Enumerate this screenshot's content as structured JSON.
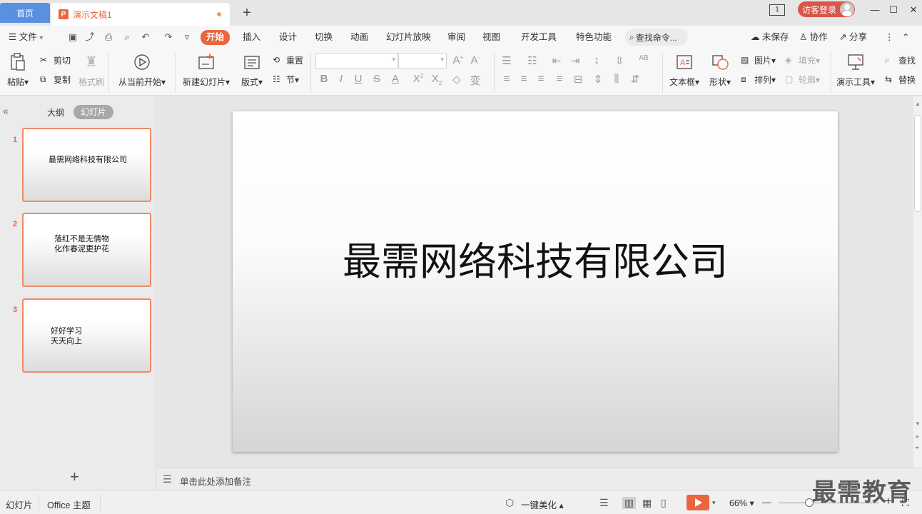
{
  "titlebar": {
    "home_tab": "首页",
    "doc_tab": "演示文稿1",
    "doc_logo": "P",
    "new_tab": "+",
    "window_badge": "1",
    "login": "访客登录",
    "minimize": "—",
    "maximize": "☐",
    "close": "✕"
  },
  "menubar": {
    "file": "文件",
    "tabs": [
      "开始",
      "插入",
      "设计",
      "切换",
      "动画",
      "幻灯片放映",
      "审阅",
      "视图",
      "开发工具",
      "特色功能"
    ],
    "search": "查找命令...",
    "unsaved": "未保存",
    "collab": "协作",
    "share": "分享"
  },
  "ribbon": {
    "paste": "粘贴",
    "cut": "剪切",
    "copy": "复制",
    "format_painter": "格式刷",
    "from_current": "从当前开始",
    "new_slide": "新建幻灯片",
    "layout": "版式",
    "reset": "重置",
    "section": "节",
    "textbox": "文本框",
    "shape": "形状",
    "picture": "图片",
    "arrange": "排列",
    "fill": "填充",
    "outline": "轮廓",
    "present_tools": "演示工具",
    "find": "查找",
    "replace": "替换"
  },
  "leftpanel": {
    "outline_tab": "大纲",
    "slides_tab": "幻灯片",
    "thumbnails": [
      {
        "num": "1",
        "text": "最需网络科技有限公司"
      },
      {
        "num": "2",
        "text": "落红不是无情物\n化作春泥更护花"
      },
      {
        "num": "3",
        "text": "好好学习\n天天向上"
      }
    ],
    "add": "+"
  },
  "slide": {
    "title": "最需网络科技有限公司"
  },
  "notes": {
    "placeholder": "单击此处添加备注"
  },
  "statusbar": {
    "slide_label": "幻灯片",
    "theme": "Office 主题",
    "beautify": "一键美化",
    "zoom": "66%",
    "zoom_minus": "—",
    "zoom_plus": "+"
  },
  "watermark": "最需教育"
}
